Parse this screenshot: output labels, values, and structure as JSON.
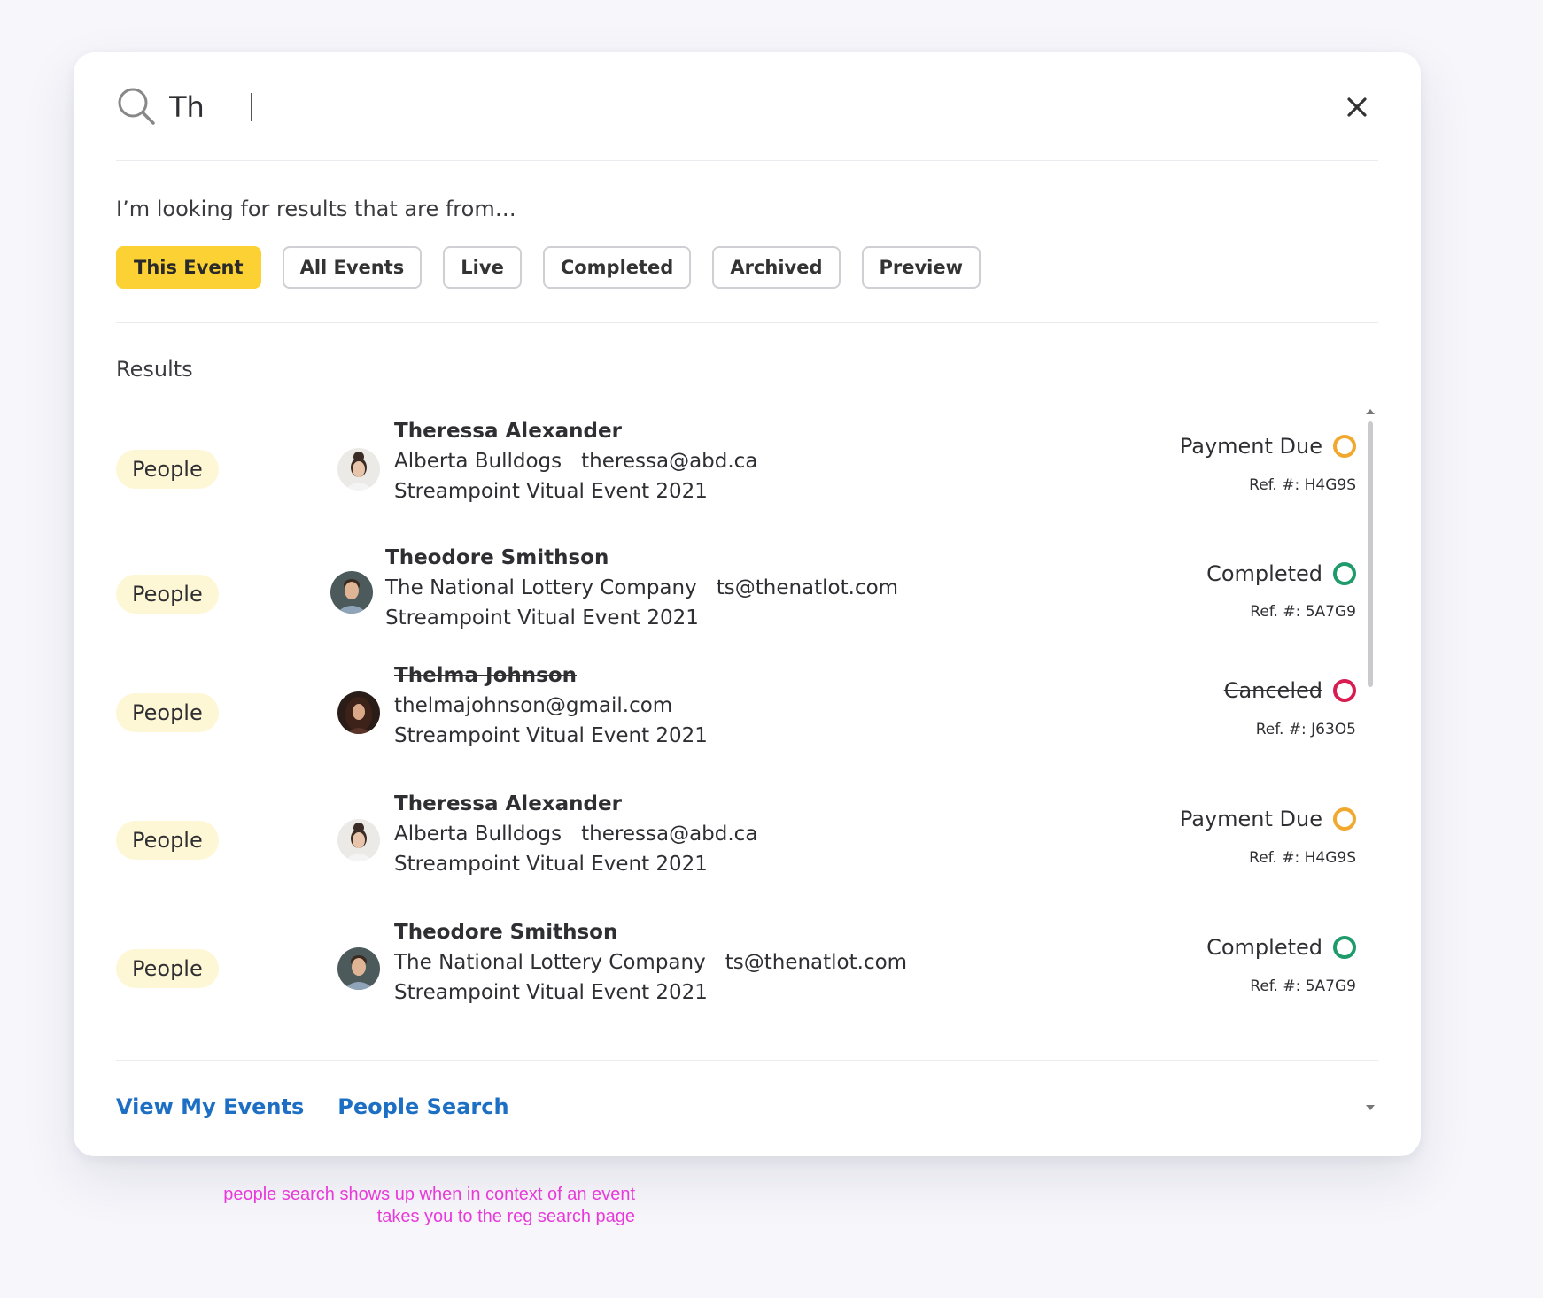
{
  "search": {
    "query": "Th"
  },
  "filters": {
    "label": "I’m looking for results that are from…",
    "chips": [
      "This Event",
      "All Events",
      "Live",
      "Completed",
      "Archived",
      "Preview"
    ],
    "active": "This Event"
  },
  "results": {
    "label": "Results",
    "items": [
      {
        "badge": "People",
        "name": "Theressa Alexander",
        "name_struck": false,
        "org": "Alberta Bulldogs",
        "email": "theressa@abd.ca",
        "event": "Streampoint Vitual Event 2021",
        "status": "Payment Due",
        "status_color": "#f0a92e",
        "status_struck": false,
        "ref": "Ref. #: H4G9S",
        "avatar": "woman-bun-avatar"
      },
      {
        "badge": "People",
        "name": "Theodore Smithson",
        "name_struck": false,
        "org": "The National Lottery Company",
        "email": "ts@thenatlot.com",
        "event": "Streampoint Vitual Event 2021",
        "status": "Completed",
        "status_color": "#1e9a6b",
        "status_struck": false,
        "ref": "Ref. #: 5A7G9",
        "avatar": "man-avatar"
      },
      {
        "badge": "People",
        "name": "Thelma Johnson",
        "name_struck": true,
        "org": "",
        "email": "thelmajohnson@gmail.com",
        "event": "Streampoint Vitual Event 2021",
        "status": "Canceled",
        "status_color": "#d81b50",
        "status_struck": true,
        "ref": "Ref. #: J63O5",
        "avatar": "woman-dark-hair-avatar"
      },
      {
        "badge": "People",
        "name": "Theressa Alexander",
        "name_struck": false,
        "org": "Alberta Bulldogs",
        "email": "theressa@abd.ca",
        "event": "Streampoint Vitual Event 2021",
        "status": "Payment Due",
        "status_color": "#f0a92e",
        "status_struck": false,
        "ref": "Ref. #: H4G9S",
        "avatar": "woman-bun-avatar"
      },
      {
        "badge": "People",
        "name": "Theodore Smithson",
        "name_struck": false,
        "org": "The National Lottery Company",
        "email": "ts@thenatlot.com",
        "event": "Streampoint Vitual Event 2021",
        "status": "Completed",
        "status_color": "#1e9a6b",
        "status_struck": false,
        "ref": "Ref. #: 5A7G9",
        "avatar": "man-avatar"
      }
    ]
  },
  "footer": {
    "view_my_events": "View My Events",
    "people_search": "People Search"
  },
  "annotation": {
    "line1": "people search shows up when in context of an event",
    "line2": "takes you to the reg search page"
  },
  "colors": {
    "accent": "#fbd133",
    "link": "#1d6fc4",
    "annotation": "#e83ad9"
  }
}
